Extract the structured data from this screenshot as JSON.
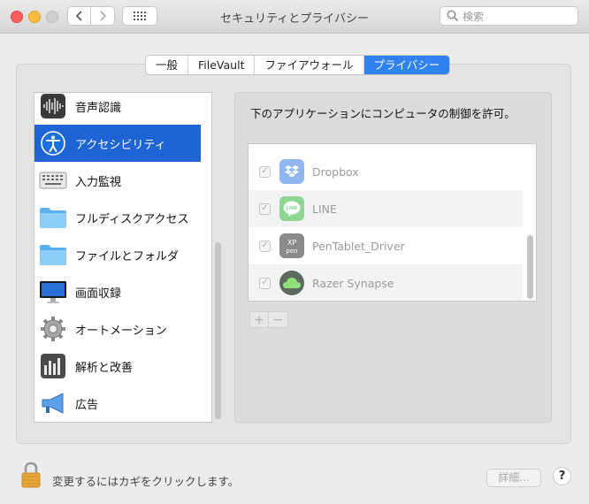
{
  "window": {
    "title": "セキュリティとプライバシー"
  },
  "toolbar": {
    "back_icon": "chevron-left-icon",
    "forward_icon": "chevron-right-icon",
    "grid_icon": "show-all-grid-icon"
  },
  "search": {
    "placeholder": "検索"
  },
  "tabs": [
    {
      "label": "一般",
      "active": false
    },
    {
      "label": "FileVault",
      "active": false
    },
    {
      "label": "ファイアウォール",
      "active": false
    },
    {
      "label": "プライバシー",
      "active": true
    }
  ],
  "sidebar": {
    "items": [
      {
        "label": "音声認識",
        "icon": "speech-recognition-icon",
        "selected": false
      },
      {
        "label": "アクセシビリティ",
        "icon": "accessibility-icon",
        "selected": true
      },
      {
        "label": "入力監視",
        "icon": "keyboard-icon",
        "selected": false
      },
      {
        "label": "フルディスクアクセス",
        "icon": "folder-icon",
        "selected": false
      },
      {
        "label": "ファイルとフォルダ",
        "icon": "folder-icon",
        "selected": false
      },
      {
        "label": "画面収録",
        "icon": "display-icon",
        "selected": false
      },
      {
        "label": "オートメーション",
        "icon": "gear-icon",
        "selected": false
      },
      {
        "label": "解析と改善",
        "icon": "analytics-chart-icon",
        "selected": false
      },
      {
        "label": "広告",
        "icon": "megaphone-icon",
        "selected": false
      }
    ]
  },
  "main": {
    "description": "下のアプリケーションにコンピュータの制御を許可。",
    "apps": [
      {
        "name": "Dropbox",
        "checked": true,
        "icon": "dropbox-icon"
      },
      {
        "name": "LINE",
        "checked": true,
        "icon": "line-app-icon"
      },
      {
        "name": "PenTablet_Driver",
        "checked": true,
        "icon": "xp-pen-icon"
      },
      {
        "name": "Razer Synapse",
        "checked": true,
        "icon": "razer-cloud-icon"
      }
    ],
    "add_label": "+",
    "remove_label": "−"
  },
  "footer": {
    "lock_text": "変更するにはカギをクリックします。",
    "advanced_label": "詳細...",
    "help_label": "?"
  },
  "colors": {
    "accent": "#2f82f0",
    "selection": "#1e64d4"
  }
}
